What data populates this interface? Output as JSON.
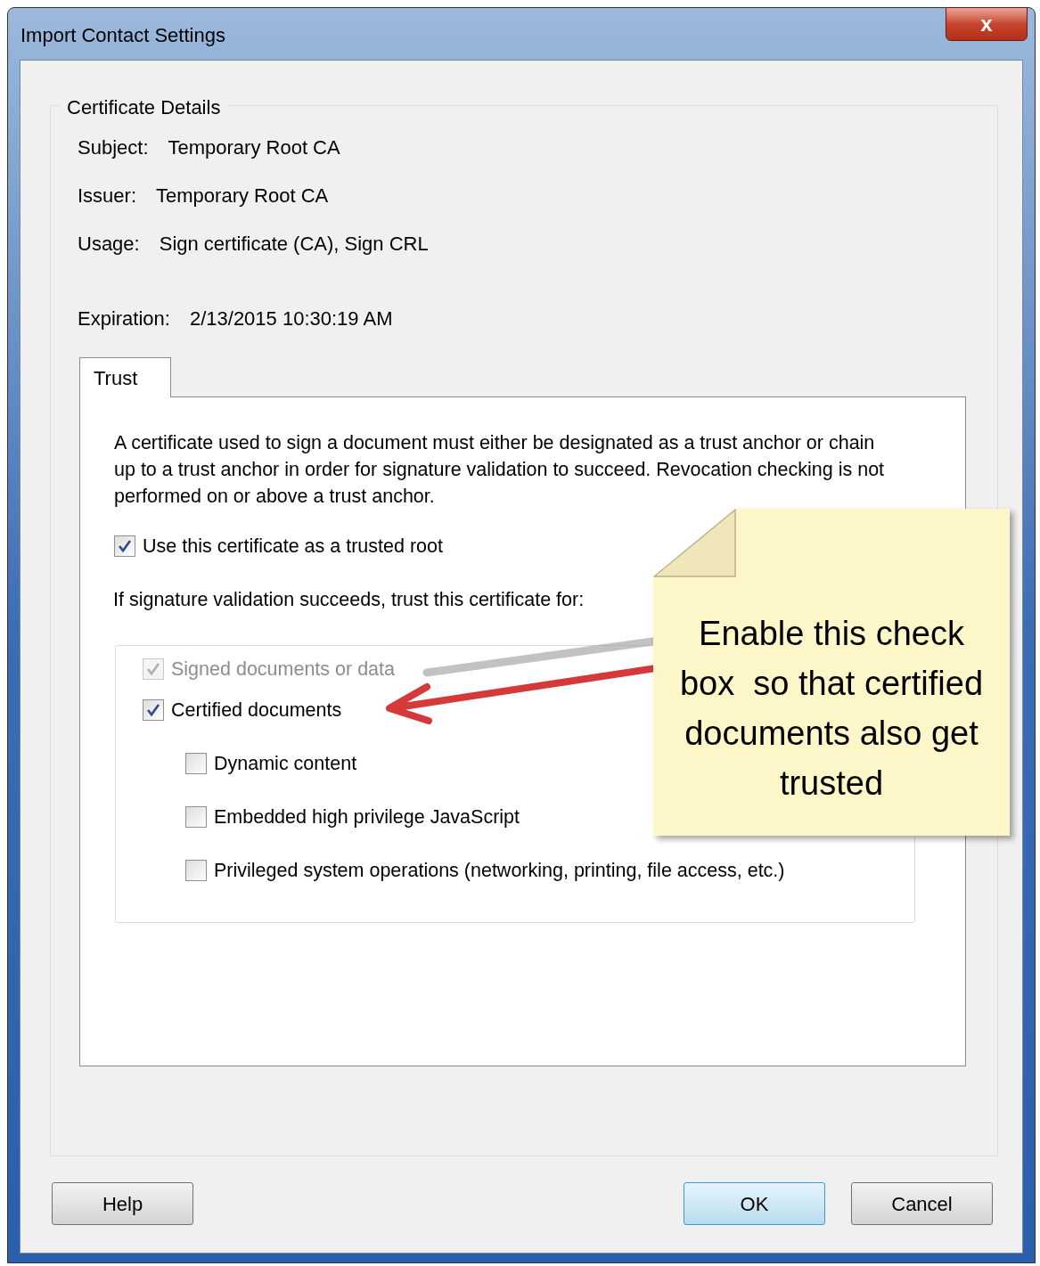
{
  "window": {
    "title": "Import Contact Settings",
    "close": "x"
  },
  "certificate_details": {
    "title": "Certificate Details",
    "fields": [
      {
        "label": "Subject:",
        "value": "Temporary Root CA"
      },
      {
        "label": "Issuer:",
        "value": "Temporary Root CA"
      },
      {
        "label": "Usage:",
        "value": "Sign certificate (CA), Sign CRL"
      },
      {
        "label": "Expiration:",
        "value": "2/13/2015 10:30:19 AM"
      }
    ]
  },
  "tabs": [
    {
      "label": "Trust",
      "selected": true
    }
  ],
  "trust": {
    "description": "A certificate used to sign a document must either be designated as a trust anchor or chain up to a trust anchor in order for signature validation to succeed.  Revocation checking is not performed on or above a trust anchor.",
    "trusted_root": {
      "label": "Use this certificate as a trusted root",
      "checked": true
    },
    "trust_for_label": "If signature validation succeeds, trust this certificate for:",
    "options": [
      {
        "label": "Signed documents or data",
        "checked": true,
        "disabled": true
      },
      {
        "label": "Certified documents",
        "checked": true,
        "disabled": false,
        "children": [
          {
            "label": "Dynamic content",
            "checked": false,
            "disabled": false
          },
          {
            "label": "Embedded high privilege JavaScript",
            "checked": false,
            "disabled": false
          },
          {
            "label": "Privileged system operations (networking, printing, file access, etc.)",
            "checked": false,
            "disabled": false
          }
        ]
      }
    ]
  },
  "callout": {
    "text": "Enable this check box  so that certified documents also get trusted"
  },
  "buttons": [
    {
      "label": "Help",
      "default": false
    },
    {
      "label": "OK",
      "default": true
    },
    {
      "label": "Cancel",
      "default": false
    }
  ]
}
